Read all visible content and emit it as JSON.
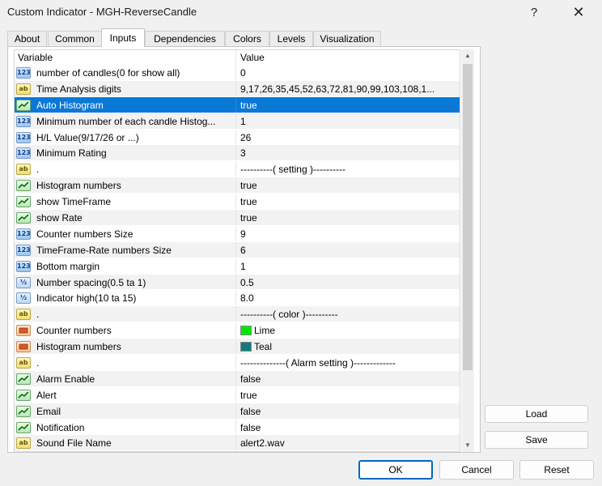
{
  "window": {
    "title": "Custom Indicator - MGH-ReverseCandle",
    "help_label": "?",
    "close_label": "✕"
  },
  "tabs": [
    {
      "label": "About"
    },
    {
      "label": "Common"
    },
    {
      "label": "Inputs"
    },
    {
      "label": "Dependencies"
    },
    {
      "label": "Colors"
    },
    {
      "label": "Levels"
    },
    {
      "label": "Visualization"
    }
  ],
  "grid": {
    "header_variable": "Variable",
    "header_value": "Value",
    "rows": [
      {
        "icon": "int-icon",
        "icon_text": "123",
        "variable": "number of candles(0 for show all)",
        "value": "0"
      },
      {
        "icon": "string-icon",
        "icon_text": "ab",
        "variable": "Time Analysis digits",
        "value": "9,17,26,35,45,52,63,72,81,90,99,103,108,1..."
      },
      {
        "icon": "bool-icon",
        "icon_text": "",
        "variable": "Auto Histogram",
        "value": "true"
      },
      {
        "icon": "int-icon",
        "icon_text": "123",
        "variable": "Minimum number of each candle Histog...",
        "value": "1"
      },
      {
        "icon": "int-icon",
        "icon_text": "123",
        "variable": "H/L Value(9/17/26 or ...)",
        "value": "26"
      },
      {
        "icon": "int-icon",
        "icon_text": "123",
        "variable": "Minimum Rating",
        "value": "3"
      },
      {
        "icon": "string-icon",
        "icon_text": "ab",
        "variable": ".",
        "value": "----------( setting )----------"
      },
      {
        "icon": "bool-icon",
        "icon_text": "",
        "variable": "Histogram numbers",
        "value": "true"
      },
      {
        "icon": "bool-icon",
        "icon_text": "",
        "variable": "show TimeFrame",
        "value": "true"
      },
      {
        "icon": "bool-icon",
        "icon_text": "",
        "variable": "show Rate",
        "value": "true"
      },
      {
        "icon": "int-icon",
        "icon_text": "123",
        "variable": "Counter numbers Size",
        "value": "9"
      },
      {
        "icon": "int-icon",
        "icon_text": "123",
        "variable": "TimeFrame-Rate numbers Size",
        "value": "6"
      },
      {
        "icon": "int-icon",
        "icon_text": "123",
        "variable": "Bottom margin",
        "value": "1"
      },
      {
        "icon": "double-icon",
        "icon_text": "½",
        "variable": "Number spacing(0.5 ta 1)",
        "value": "0.5"
      },
      {
        "icon": "double-icon",
        "icon_text": "½",
        "variable": "Indicator high(10 ta 15)",
        "value": "8.0"
      },
      {
        "icon": "string-icon",
        "icon_text": "ab",
        "variable": ".",
        "value": "----------( color )----------"
      },
      {
        "icon": "color-icon",
        "icon_text": "",
        "variable": "Counter numbers",
        "value": "Lime",
        "swatch": "#00e600"
      },
      {
        "icon": "color-icon",
        "icon_text": "",
        "variable": "Histogram numbers",
        "value": "Teal",
        "swatch": "#107c7c"
      },
      {
        "icon": "string-icon",
        "icon_text": "ab",
        "variable": ".",
        "value": "--------------( Alarm setting )-------------"
      },
      {
        "icon": "bool-icon",
        "icon_text": "",
        "variable": "Alarm Enable",
        "value": "false"
      },
      {
        "icon": "bool-icon",
        "icon_text": "",
        "variable": "Alert",
        "value": "true"
      },
      {
        "icon": "bool-icon",
        "icon_text": "",
        "variable": "Email",
        "value": "false"
      },
      {
        "icon": "bool-icon",
        "icon_text": "",
        "variable": "Notification",
        "value": "false"
      },
      {
        "icon": "string-icon",
        "icon_text": "ab",
        "variable": "Sound File Name",
        "value": "alert2.wav"
      }
    ]
  },
  "side_buttons": {
    "load": "Load",
    "save": "Save"
  },
  "footer_buttons": {
    "ok": "OK",
    "cancel": "Cancel",
    "reset": "Reset"
  },
  "colors": {
    "selection": "#0a78d7",
    "accent": "#0067c0"
  }
}
